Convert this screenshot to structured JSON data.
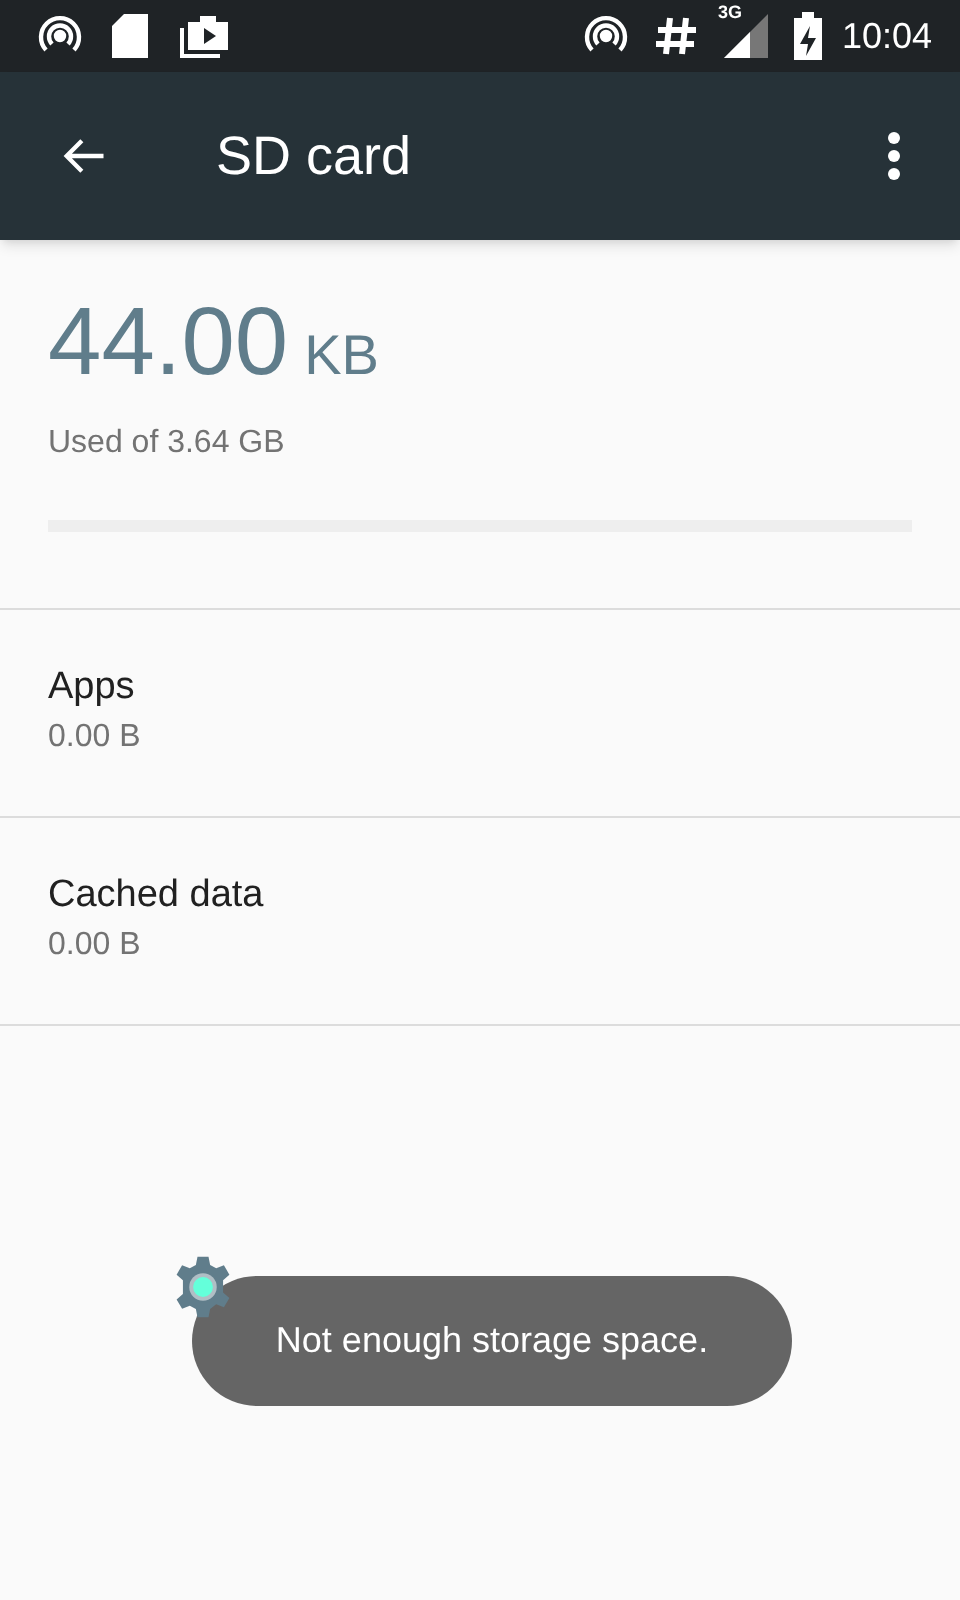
{
  "status_bar": {
    "time": "10:04",
    "network": "3G"
  },
  "app_bar": {
    "title": "SD card"
  },
  "storage": {
    "used_value": "44.00",
    "used_unit": "KB",
    "summary": "Used of 3.64 GB",
    "level": 0
  },
  "items": [
    {
      "title": "Apps",
      "value": "0.00 B"
    },
    {
      "title": "Cached data",
      "value": "0.00 B"
    }
  ],
  "toast": {
    "message": "Not enough storage space."
  }
}
